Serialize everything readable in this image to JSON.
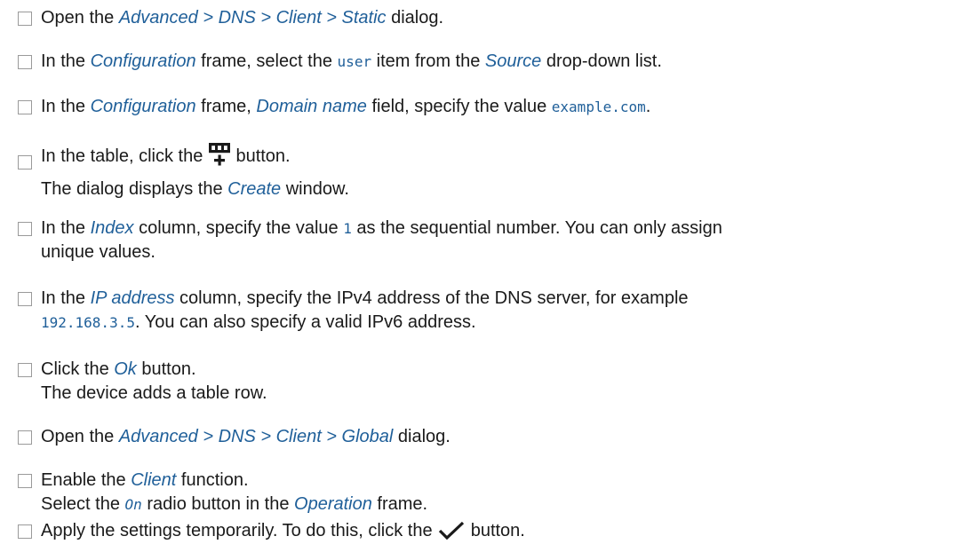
{
  "steps": [
    {
      "parts": [
        {
          "t": "Open the "
        },
        {
          "ui": "Advanced > DNS > Client > Static"
        },
        {
          "t": " dialog."
        }
      ]
    },
    {
      "parts": [
        {
          "t": "In the "
        },
        {
          "ui": "Configuration"
        },
        {
          "t": " frame, select the "
        },
        {
          "code": "user"
        },
        {
          "t": " item from the "
        },
        {
          "ui": "Source"
        },
        {
          "t": " drop-down list."
        }
      ]
    },
    {
      "parts": [
        {
          "t": "In the "
        },
        {
          "ui": "Configuration"
        },
        {
          "t": " frame, "
        },
        {
          "ui": "Domain name"
        },
        {
          "t": " field, specify the value "
        },
        {
          "code": "example.com"
        },
        {
          "t": "."
        }
      ]
    },
    {
      "parts": [
        {
          "t": "In the table, click the "
        },
        {
          "icon": "add-table-row-icon"
        },
        {
          "t": " button."
        }
      ],
      "result": [
        {
          "t": "The dialog displays the "
        },
        {
          "ui": "Create"
        },
        {
          "t": " window."
        }
      ]
    },
    {
      "parts": [
        {
          "t": "In the "
        },
        {
          "ui": "Index"
        },
        {
          "t": " column, specify the value "
        },
        {
          "code": "1"
        },
        {
          "t": " as the sequential number. You can only assign"
        }
      ],
      "cont": [
        {
          "t": "unique values."
        }
      ]
    },
    {
      "parts": [
        {
          "t": "In the "
        },
        {
          "ui": "IP address"
        },
        {
          "t": " column, specify the IPv4 address of the DNS server, for example"
        }
      ],
      "cont": [
        {
          "code": "192.168.3.5"
        },
        {
          "t": ". You can also specify a valid IPv6 address."
        }
      ]
    },
    {
      "parts": [
        {
          "t": "Click the "
        },
        {
          "ui": "Ok"
        },
        {
          "t": " button."
        }
      ],
      "result": [
        {
          "t": "The device adds a table row."
        }
      ]
    },
    {
      "parts": [
        {
          "t": "Open the "
        },
        {
          "ui": "Advanced > DNS > Client > Global"
        },
        {
          "t": " dialog."
        }
      ]
    },
    {
      "parts": [
        {
          "t": "Enable the "
        },
        {
          "ui": "Client"
        },
        {
          "t": " function."
        }
      ],
      "result": [
        {
          "t": "Select the "
        },
        {
          "codei": "On"
        },
        {
          "t": " radio button in the "
        },
        {
          "ui": "Operation"
        },
        {
          "t": " frame."
        }
      ]
    },
    {
      "parts": [
        {
          "t": "Apply the settings temporarily. To do this, click the "
        },
        {
          "icon": "checkmark-icon"
        },
        {
          "t": " button."
        }
      ]
    }
  ],
  "icons": {
    "add-table-row-icon": "table with plus sign",
    "checkmark-icon": "check mark"
  },
  "colors": {
    "ui_reference": "#1f5f99",
    "body_text": "#1a1a1a",
    "checkbox_border": "#9a9a9a"
  }
}
